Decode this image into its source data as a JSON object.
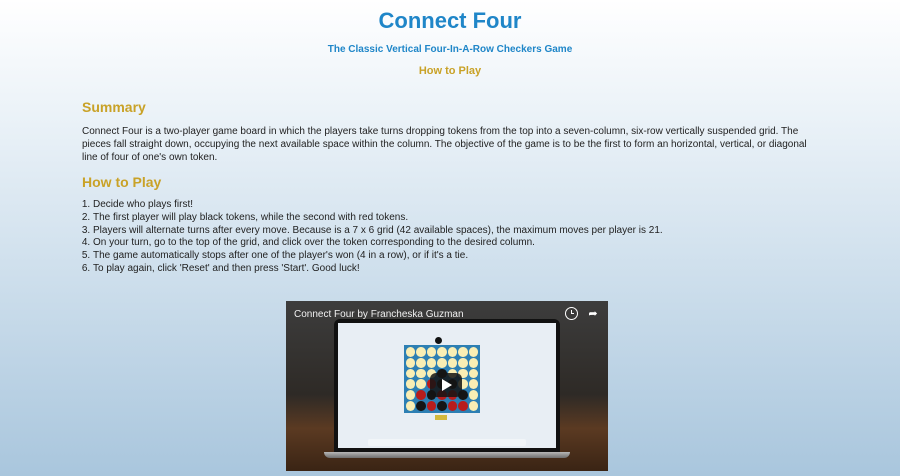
{
  "header": {
    "title": "Connect Four",
    "subtitle": "The Classic Vertical Four-In-A-Row Checkers Game",
    "howto_link": "How to Play"
  },
  "summary": {
    "heading": "Summary",
    "text": "Connect Four is a two-player game board in which the players take turns dropping tokens from the top into a seven-column, six-row vertically suspended grid. The pieces fall straight down, occupying the next available space within the column. The objective of the game is to be the first to form an horizontal, vertical, or diagonal line of four of one's own token."
  },
  "howto": {
    "heading": "How to Play",
    "steps": [
      "Decide who plays first!",
      "The first player will play black tokens, while the second with red tokens.",
      "Players will alternate turns after every move. Because is a 7 x 6 grid (42 available spaces), the maximum moves per player is 21.",
      "On your turn, go to the top of the grid, and click over the token corresponding to the desired column.",
      "The game automatically stops after one of the player's won (4 in a row), or if it's a tie.",
      "To play again, click 'Reset' and then press 'Start'. Good luck!"
    ]
  },
  "video": {
    "title": "Connect Four by Francheska Guzman",
    "watch_later_icon": "clock-icon",
    "share_icon": "share-icon",
    "play_icon": "play-icon"
  },
  "colors": {
    "title_blue": "#1f86c8",
    "heading_gold": "#c9a227",
    "board_blue": "#2d7fb3",
    "token_red": "#b71c1c",
    "token_black": "#151515"
  }
}
